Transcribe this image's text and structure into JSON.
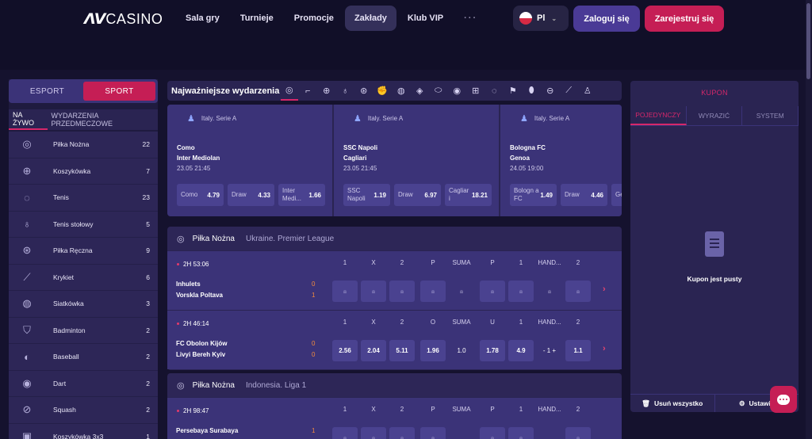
{
  "header": {
    "logo_mark": "ᐱV",
    "logo_text": "CASINO",
    "nav": [
      {
        "label": "Sala gry"
      },
      {
        "label": "Turnieje"
      },
      {
        "label": "Promocje"
      },
      {
        "label": "Zakłady"
      },
      {
        "label": "Klub VIP"
      }
    ],
    "more_label": "···",
    "lang": "Pl",
    "login_label": "Zaloguj się",
    "register_label": "Zarejestruj się"
  },
  "left": {
    "segment": [
      "ESPORT",
      "SPORT"
    ],
    "tabs": [
      "NA ŻYWO",
      "WYDARZENIA PRZEDMECZOWE"
    ],
    "sports": [
      {
        "name": "Piłka Nożna",
        "count": "22",
        "icon": "soccer-icon"
      },
      {
        "name": "Koszykówka",
        "count": "7",
        "icon": "basketball-icon"
      },
      {
        "name": "Tenis",
        "count": "23",
        "icon": "tennis-icon"
      },
      {
        "name": "Tenis stołowy",
        "count": "5",
        "icon": "table-tennis-icon"
      },
      {
        "name": "Piłka Ręczna",
        "count": "9",
        "icon": "handball-icon"
      },
      {
        "name": "Krykiet",
        "count": "6",
        "icon": "cricket-icon"
      },
      {
        "name": "Siatkówka",
        "count": "3",
        "icon": "volleyball-icon"
      },
      {
        "name": "Badminton",
        "count": "2",
        "icon": "badminton-icon"
      },
      {
        "name": "Baseball",
        "count": "2",
        "icon": "baseball-icon"
      },
      {
        "name": "Dart",
        "count": "2",
        "icon": "dart-icon"
      },
      {
        "name": "Squash",
        "count": "2",
        "icon": "squash-icon"
      },
      {
        "name": "Koszykówka 3x3",
        "count": "1",
        "icon": "basketball-3x3-icon"
      }
    ]
  },
  "top": {
    "title": "Najważniejsze wydarzenia",
    "icons": [
      "soccer-icon",
      "hockey-icon",
      "basketball-icon",
      "table-tennis-icon",
      "handball-icon",
      "boxing-icon",
      "volleyball-icon",
      "snooker-icon",
      "rugby-icon",
      "dart-icon",
      "futsal-icon",
      "tennis-icon",
      "golf-icon",
      "american-football-icon",
      "aussie-rules-icon",
      "cricket-icon",
      "athletics-icon"
    ]
  },
  "featured": [
    {
      "league": "Italy. Serie A",
      "team1": "Como",
      "team2": "Inter Mediolan",
      "date": "23.05  21:45",
      "odds": [
        {
          "name": "Como",
          "value": "4.79"
        },
        {
          "name": "Draw",
          "value": "4.33"
        },
        {
          "name": "Inter Medi...",
          "value": "1.66"
        }
      ]
    },
    {
      "league": "Italy. Serie A",
      "team1": "SSC Napoli",
      "team2": "Cagliari",
      "date": "23.05  21:45",
      "odds": [
        {
          "name": "SSC Napoli",
          "value": "1.19"
        },
        {
          "name": "Draw",
          "value": "6.97"
        },
        {
          "name": "Cagliar i",
          "value": "18.21"
        }
      ]
    },
    {
      "league": "Italy. Serie A",
      "team1": "Bologna FC",
      "team2": "Genoa",
      "date": "24.05  19:00",
      "odds": [
        {
          "name": "Bologn a FC",
          "value": "1.49"
        },
        {
          "name": "Draw",
          "value": "4.46"
        },
        {
          "name": "Ge",
          "value": ""
        }
      ]
    }
  ],
  "blocks": [
    {
      "sport": "Piłka Nożna",
      "league": "Ukraine. Premier League",
      "matches": [
        {
          "time": "2H  53:06",
          "team1": "Inhulets",
          "team2": "Vorskla Poltava",
          "score1": "0",
          "score2": "1",
          "heads": [
            "1",
            "X",
            "2",
            "P",
            "SUMA",
            "P",
            "1",
            "HAND...",
            "2"
          ],
          "cells": [
            "lock",
            "lock",
            "lock",
            "lock",
            "empty",
            "lock",
            "lock",
            "empty",
            "lock"
          ]
        },
        {
          "time": "2H  46:14",
          "team1": "FC Obolon Kijów",
          "team2": "Livyi Bereh Kyiv",
          "score1": "0",
          "score2": "0",
          "heads": [
            "1",
            "X",
            "2",
            "O",
            "SUMA",
            "U",
            "1",
            "HAND...",
            "2"
          ],
          "cells": [
            "2.56",
            "2.04",
            "5.11",
            "1.96",
            "1.0",
            "1.78",
            "4.9",
            "- 1 +",
            "1.1"
          ]
        }
      ]
    },
    {
      "sport": "Piłka Nożna",
      "league": "Indonesia. Liga 1",
      "matches": [
        {
          "time": "2H  98:47",
          "team1": "Persebaya Surabaya",
          "team2": "",
          "score1": "1",
          "score2": "",
          "heads": [
            "1",
            "X",
            "2",
            "P",
            "SUMA",
            "P",
            "1",
            "HAND...",
            "2"
          ],
          "cells": [
            "lock",
            "lock",
            "lock",
            "lock",
            "empty",
            "lock",
            "lock",
            "empty",
            "lock"
          ]
        }
      ]
    }
  ],
  "kupon": {
    "title": "KUPON",
    "tabs": [
      "POJEDYNCZY",
      "WYRAZIĆ",
      "SYSTEM"
    ],
    "empty": "Kupon jest pusty",
    "clear_label": "Usuń wszystko",
    "settings_label": "Ustawie"
  },
  "colors": {
    "accent": "#c51e55",
    "panel": "#3b3378",
    "bg": "#15122e"
  }
}
